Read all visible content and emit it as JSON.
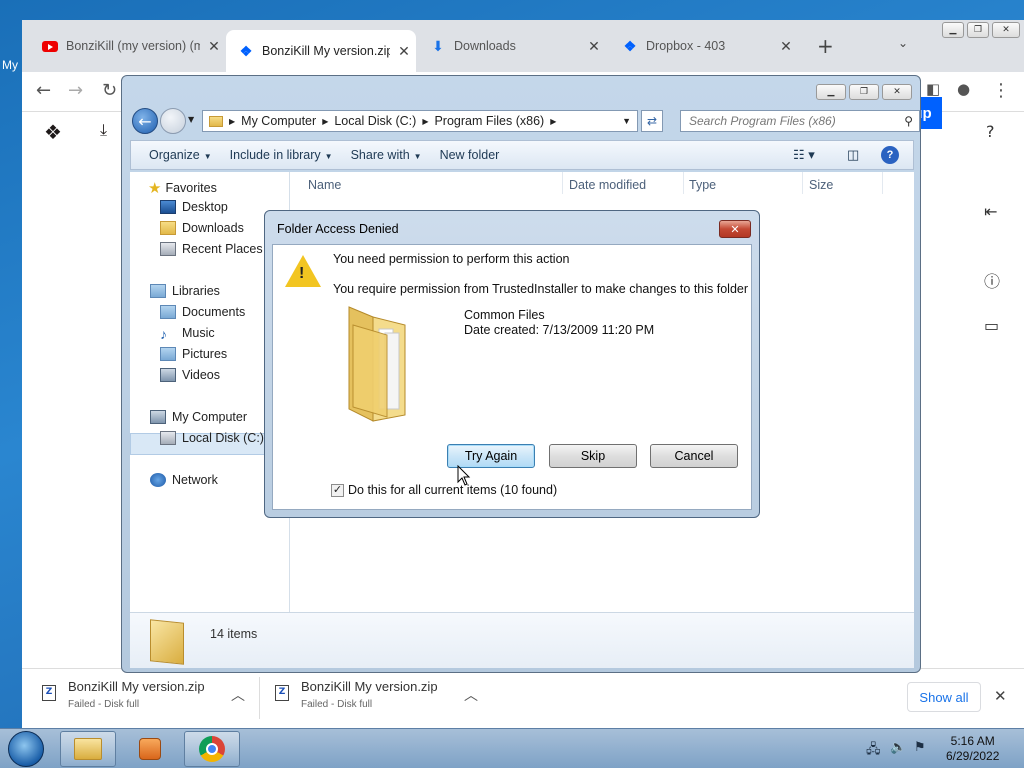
{
  "desktop": {
    "icon_label": "My"
  },
  "browser": {
    "tabs": [
      {
        "title": "BonziKill (my version) (m",
        "icon": "youtube-icon",
        "active": false
      },
      {
        "title": "BonziKill My version.zip",
        "icon": "dropbox-icon",
        "active": true
      },
      {
        "title": "Downloads",
        "icon": "download-icon",
        "active": false
      },
      {
        "title": "Dropbox - 403",
        "icon": "dropbox-icon",
        "active": false
      }
    ],
    "page": {
      "signup_label": "n up"
    },
    "downloads": [
      {
        "name": "BonziKill My version.zip",
        "status": "Failed - Disk full"
      },
      {
        "name": "BonziKill My version.zip",
        "status": "Failed - Disk full"
      }
    ],
    "show_all_label": "Show all"
  },
  "explorer": {
    "breadcrumb": [
      "My Computer",
      "Local Disk (C:)",
      "Program Files (x86)"
    ],
    "search_placeholder": "Search Program Files (x86)",
    "commands": {
      "organize": "Organize",
      "include": "Include in library",
      "share": "Share with",
      "new_folder": "New folder"
    },
    "nav": {
      "favorites": "Favorites",
      "desktop": "Desktop",
      "downloads": "Downloads",
      "recent": "Recent Places",
      "libraries": "Libraries",
      "documents": "Documents",
      "music": "Music",
      "pictures": "Pictures",
      "videos": "Videos",
      "computer": "My Computer",
      "local_disk": "Local Disk (C:)",
      "network": "Network"
    },
    "columns": [
      "Name",
      "Date modified",
      "Type",
      "Size"
    ],
    "item_count": "14 items"
  },
  "dialog": {
    "title": "Folder Access Denied",
    "message": "You need permission to perform this action",
    "detail": "You require permission from TrustedInstaller to make changes to this folder",
    "folder_name": "Common Files",
    "date_created": "Date created: 7/13/2009 11:20 PM",
    "buttons": {
      "try_again": "Try Again",
      "skip": "Skip",
      "cancel": "Cancel"
    },
    "checkbox_label": "Do this for all current items (10 found)",
    "checkbox_checked": true
  },
  "taskbar": {
    "time": "5:16 AM",
    "date": "6/29/2022"
  }
}
